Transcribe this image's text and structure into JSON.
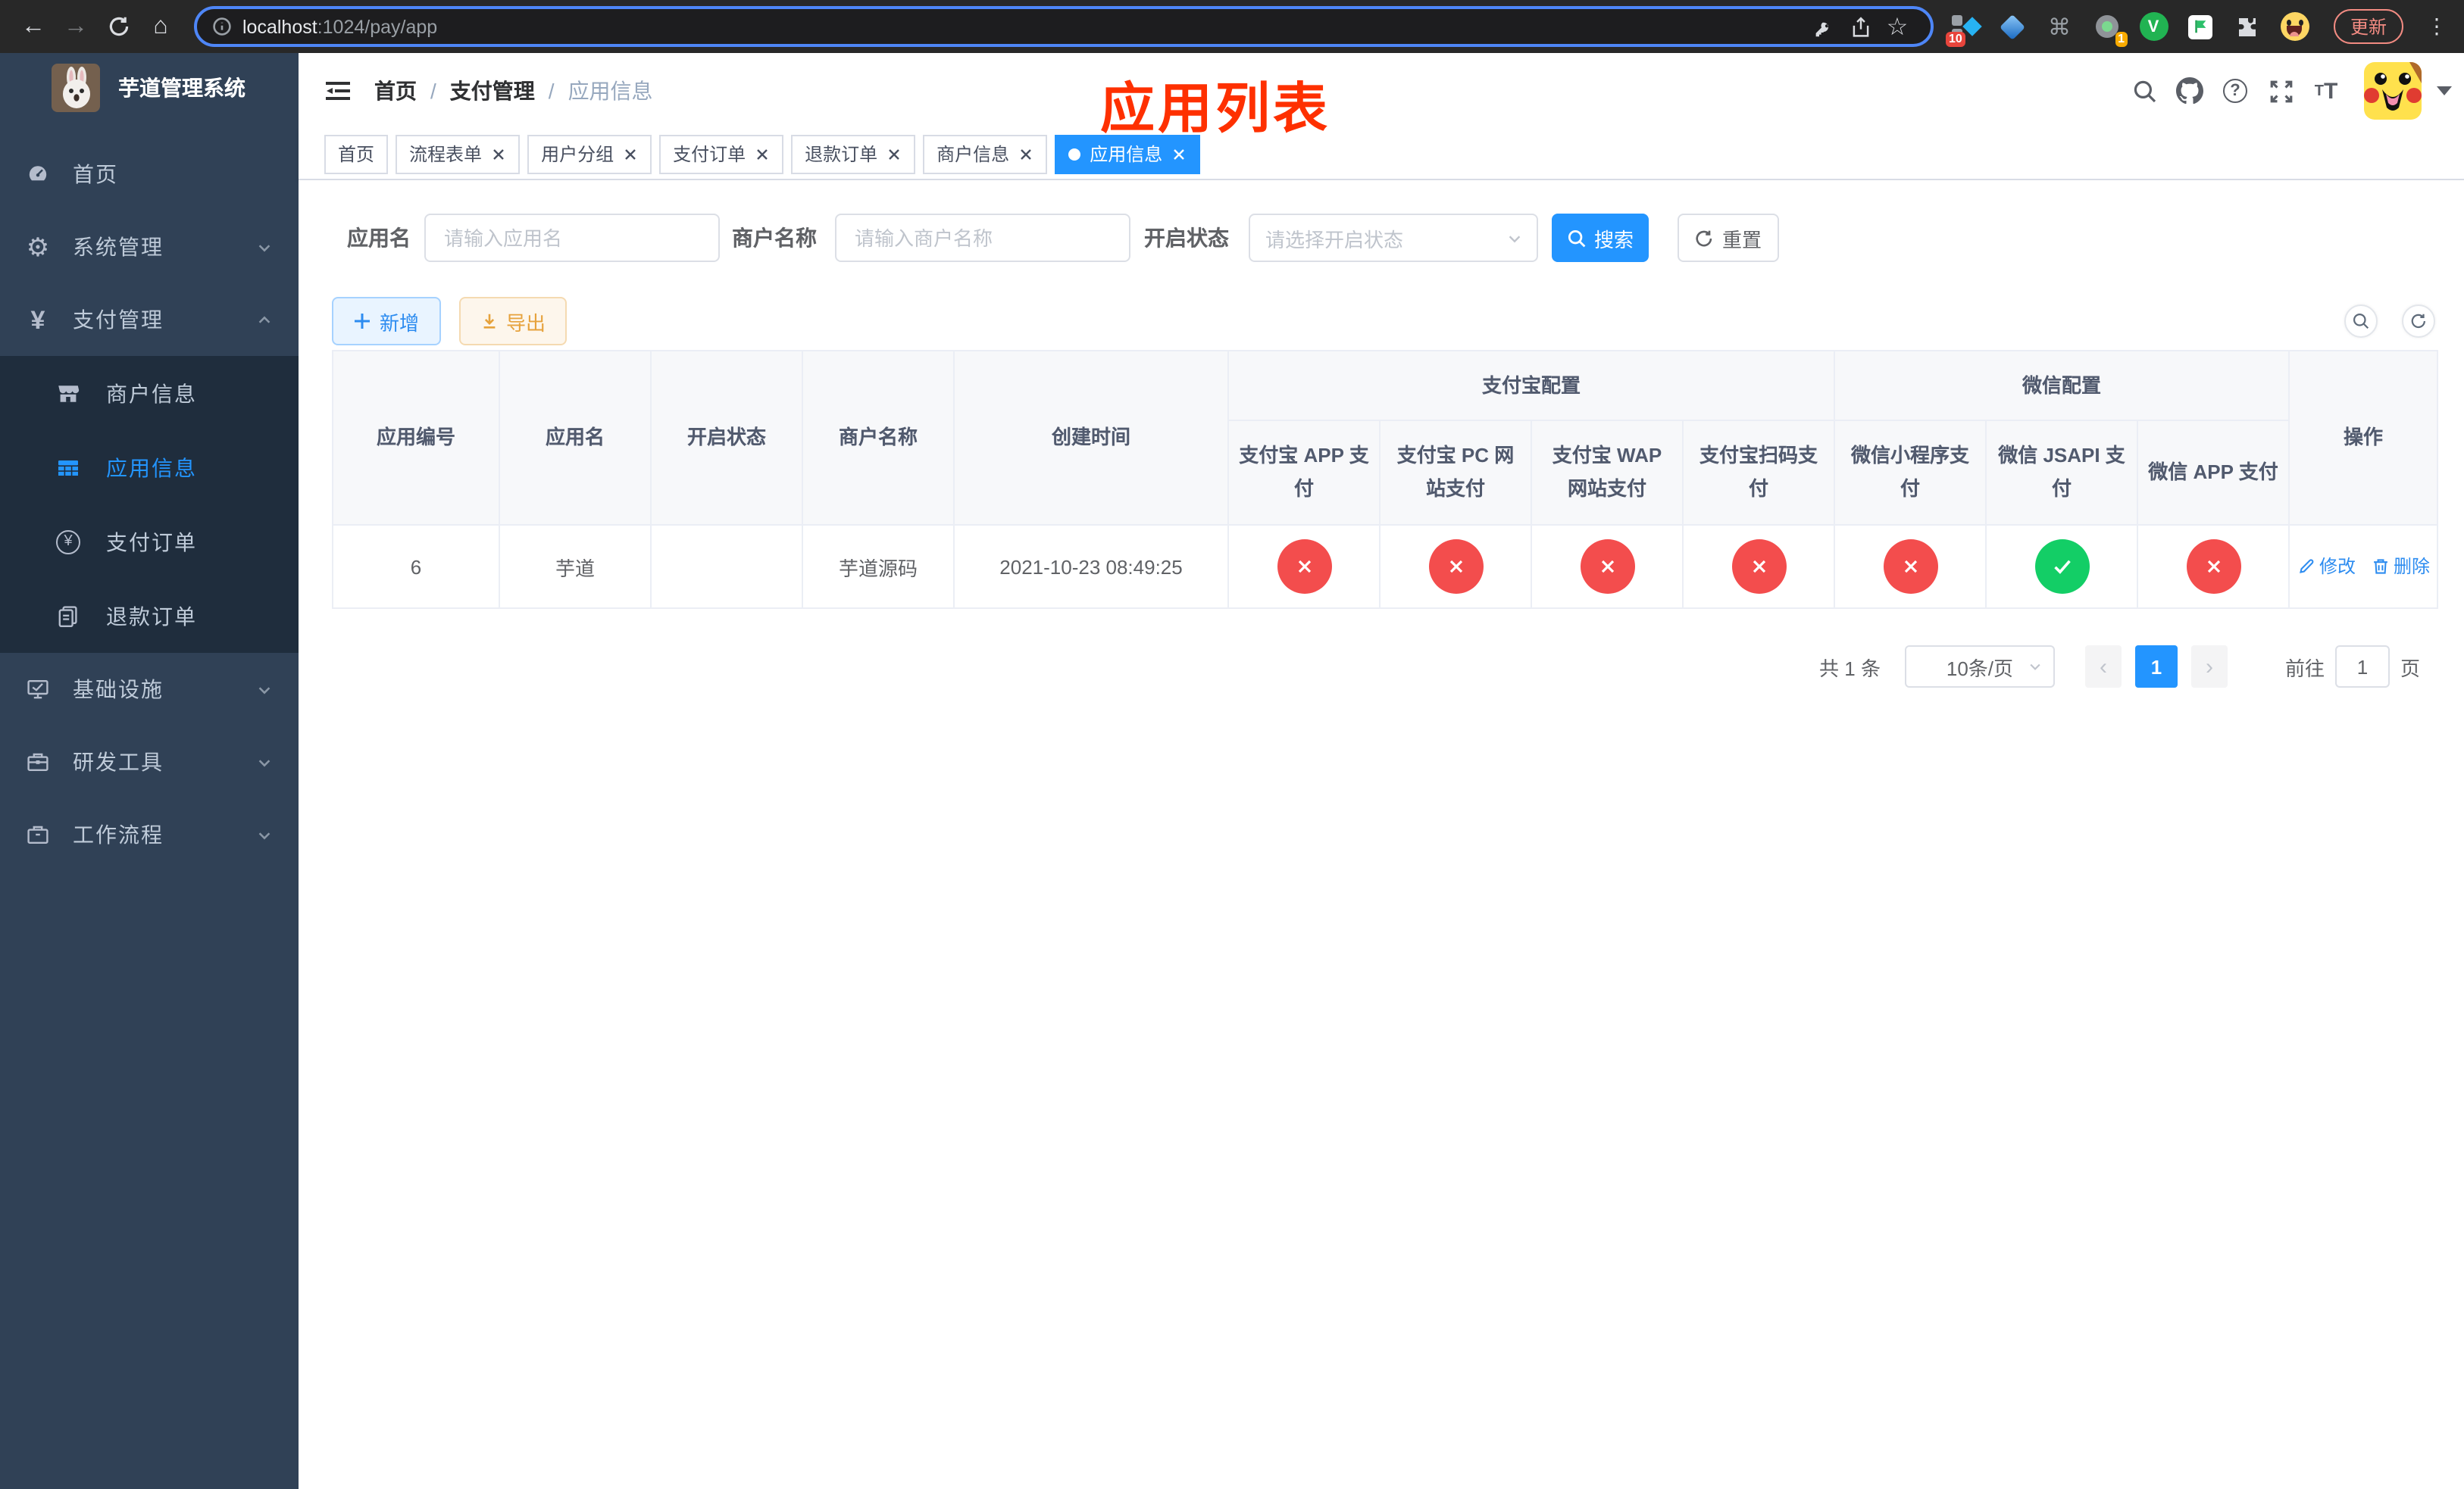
{
  "glyphs": {
    "back": "←",
    "forward": "→",
    "home": "⌂",
    "star": "☆",
    "cmd": "⌘",
    "dots": "⋮",
    "gear": "⚙",
    "yen": "¥",
    "help": "?",
    "prev": "‹",
    "next": "›"
  },
  "browser": {
    "url_host": "localhost",
    "url_rest": ":1024/pay/app",
    "ext_badge_a": "10",
    "ext_badge_b": "1",
    "ext_v": "V",
    "update_label": "更新"
  },
  "sidebar": {
    "title": "芋道管理系统",
    "items": [
      {
        "label": "首页"
      },
      {
        "label": "系统管理"
      },
      {
        "label": "支付管理"
      },
      {
        "label": "商户信息"
      },
      {
        "label": "应用信息"
      },
      {
        "label": "支付订单"
      },
      {
        "label": "退款订单"
      },
      {
        "label": "基础设施"
      },
      {
        "label": "研发工具"
      },
      {
        "label": "工作流程"
      }
    ]
  },
  "header": {
    "breadcrumb": [
      "首页",
      "支付管理",
      "应用信息"
    ],
    "separator": "/",
    "annotation": "应用列表"
  },
  "tabs": [
    {
      "label": "首页"
    },
    {
      "label": "流程表单"
    },
    {
      "label": "用户分组"
    },
    {
      "label": "支付订单"
    },
    {
      "label": "退款订单"
    },
    {
      "label": "商户信息"
    },
    {
      "label": "应用信息"
    }
  ],
  "filters": {
    "app_name_label": "应用名",
    "app_name_placeholder": "请输入应用名",
    "merchant_label": "商户名称",
    "merchant_placeholder": "请输入商户名称",
    "status_label": "开启状态",
    "status_placeholder": "请选择开启状态",
    "search_label": "搜索",
    "reset_label": "重置"
  },
  "toolbar": {
    "add_label": "新增",
    "export_label": "导出"
  },
  "table": {
    "headers": {
      "app_id": "应用编号",
      "app_name": "应用名",
      "status": "开启状态",
      "merchant": "商户名称",
      "created": "创建时间",
      "alipay_group": "支付宝配置",
      "wechat_group": "微信配置",
      "sub": [
        "支付宝 APP 支付",
        "支付宝 PC 网站支付",
        "支付宝 WAP 网站支付",
        "支付宝扫码支付",
        "微信小程序支付",
        "微信 JSAPI 支付",
        "微信 APP 支付"
      ],
      "ops": "操作"
    },
    "row": {
      "id": "6",
      "name": "芋道",
      "enabled": true,
      "merchant": "芋道源码",
      "created": "2021-10-23 08:49:25",
      "configs": [
        false,
        false,
        false,
        false,
        false,
        true,
        false
      ],
      "edit_label": "修改",
      "delete_label": "删除"
    }
  },
  "pagination": {
    "total": "共 1 条",
    "page_size": "10条/页",
    "current": "1",
    "goto_label": "前往",
    "goto_value": "1",
    "page_unit": "页"
  },
  "colors": {
    "primary": "#2395ff",
    "danger": "#f34d4d",
    "success": "#13ce66",
    "sidebar": "#304156"
  }
}
